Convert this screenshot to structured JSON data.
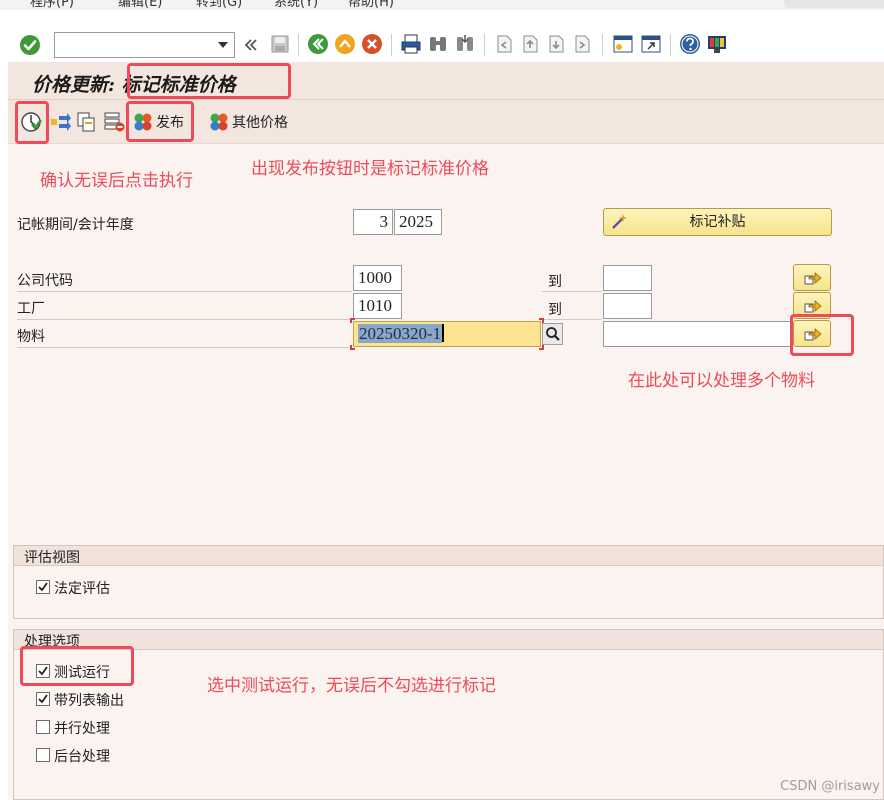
{
  "menu": {
    "items": [
      "程序(P)",
      "编辑(E)",
      "转到(G)",
      "系统(Y)",
      "帮助(H)"
    ]
  },
  "toolbar": {
    "command_field_value": ""
  },
  "page": {
    "title": "价格更新: 标记标准价格"
  },
  "app_toolbar": {
    "release_label": "发布",
    "other_prices_label": "其他价格"
  },
  "annotations": {
    "execute": "确认无误后点击执行",
    "release": "出现发布按钮时是标记标准价格",
    "multi_material": "在此处可以处理多个物料",
    "test_run": "选中测试运行，无误后不勾选进行标记"
  },
  "form": {
    "period_label": "记帐期间/会计年度",
    "period_value": "3",
    "year_value": "2025",
    "mark_allowance_label": "标记补贴",
    "company_code_label": "公司代码",
    "company_code_value": "1000",
    "company_code_to_label": "到",
    "company_code_to_value": "",
    "plant_label": "工厂",
    "plant_value": "1010",
    "plant_to_label": "到",
    "plant_to_value": "",
    "material_label": "物料",
    "material_value": "20250320-1",
    "material_to_value": ""
  },
  "valuation_view": {
    "title": "评估视图",
    "statutory_label": "法定评估",
    "statutory_checked": true
  },
  "processing_options": {
    "title": "处理选项",
    "test_run_label": "测试运行",
    "test_run_checked": true,
    "list_output_label": "带列表输出",
    "list_output_checked": true,
    "parallel_label": "并行处理",
    "parallel_checked": false,
    "background_label": "后台处理",
    "background_checked": false
  },
  "watermark": "CSDN @irisawy",
  "colors": {
    "annotation_red": "#ec4b5b",
    "background": "#fbf3ef",
    "focus_yellow": "#fbe392"
  }
}
